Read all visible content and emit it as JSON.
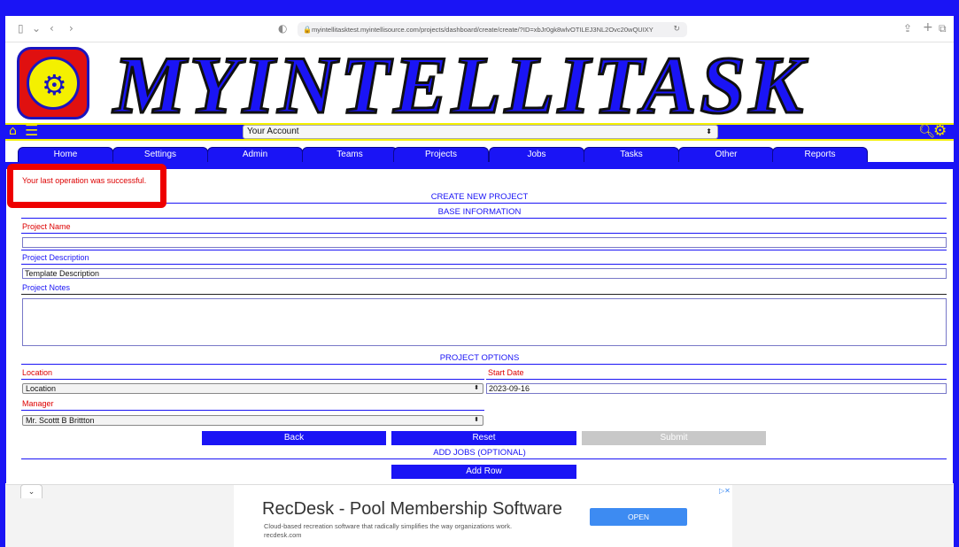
{
  "browser": {
    "url": "myintellitasktest.myintellisource.com/projects/dashboard/create/create/?ID=xbJr0gk8wlvOTILEJ3NL2Ovc20wQUIXY",
    "icons": [
      "sidebar-icon",
      "back-icon",
      "forward-icon",
      "shield-icon",
      "lock-icon",
      "reload-icon",
      "share-icon",
      "new-tab-icon",
      "tabs-icon"
    ]
  },
  "brand": {
    "name": "MYINTELLITASK"
  },
  "account_bar": {
    "selected": "Your Account"
  },
  "tabs": [
    "Home",
    "Settings",
    "Admin",
    "Teams",
    "Projects",
    "Jobs",
    "Tasks",
    "Other",
    "Reports"
  ],
  "message": "Your last operation was successful.",
  "form": {
    "heading": "CREATE NEW PROJECT",
    "base_heading": "BASE INFORMATION",
    "project_name_label": "Project Name",
    "project_name_value": "",
    "project_description_label": "Project Description",
    "project_description_value": "Template Description",
    "project_notes_label": "Project Notes",
    "options_heading": "PROJECT OPTIONS",
    "location_label": "Location",
    "location_value": "Location",
    "start_date_label": "Start Date",
    "start_date_value": "2023-09-16",
    "manager_label": "Manager",
    "manager_value": "Mr. Scottt B Brittton",
    "back_label": "Back",
    "reset_label": "Reset",
    "submit_label": "Submit",
    "jobs_heading": "ADD JOBS (OPTIONAL)",
    "add_row_label": "Add Row"
  },
  "ad": {
    "title": "RecDesk - Pool Membership Software",
    "description": "Cloud-based recreation software that radically simplifies the way organizations work.",
    "domain": "recdesk.com",
    "cta": "OPEN"
  },
  "colors": {
    "brand_blue": "#1a14f5",
    "accent_yellow": "#f4f000",
    "error_red": "#ee0000"
  }
}
